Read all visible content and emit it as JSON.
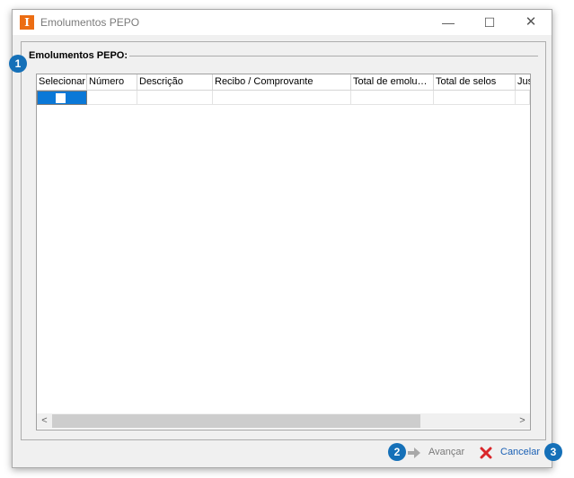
{
  "window": {
    "title": "Emolumentos PEPO",
    "app_icon_letter": "I",
    "minimize_glyph": "—",
    "maximize_glyph": "☐",
    "close_glyph": "✕"
  },
  "group": {
    "title": "Emolumentos PEPO:"
  },
  "grid": {
    "columns": [
      "Selecionar",
      "Número",
      "Descrição",
      "Recibo / Comprovante",
      "Total de emolu…",
      "Total de selos",
      "Jus"
    ],
    "rows": [
      {
        "selecionar": false,
        "numero": "",
        "descricao": "",
        "recibo": "",
        "total_emolumentos": "",
        "total_selos": "",
        "jus": ""
      }
    ],
    "scroll_left_glyph": "<",
    "scroll_right_glyph": ">"
  },
  "buttons": {
    "avancar_label": "Avançar",
    "cancelar_label": "Cancelar"
  },
  "badges": [
    "1",
    "2",
    "3"
  ],
  "colors": {
    "accent": "#0a78d7",
    "badge": "#1570b8",
    "app_icon": "#ec6d13",
    "cancel_x": "#d9262a",
    "link_text": "#1a60b5"
  }
}
